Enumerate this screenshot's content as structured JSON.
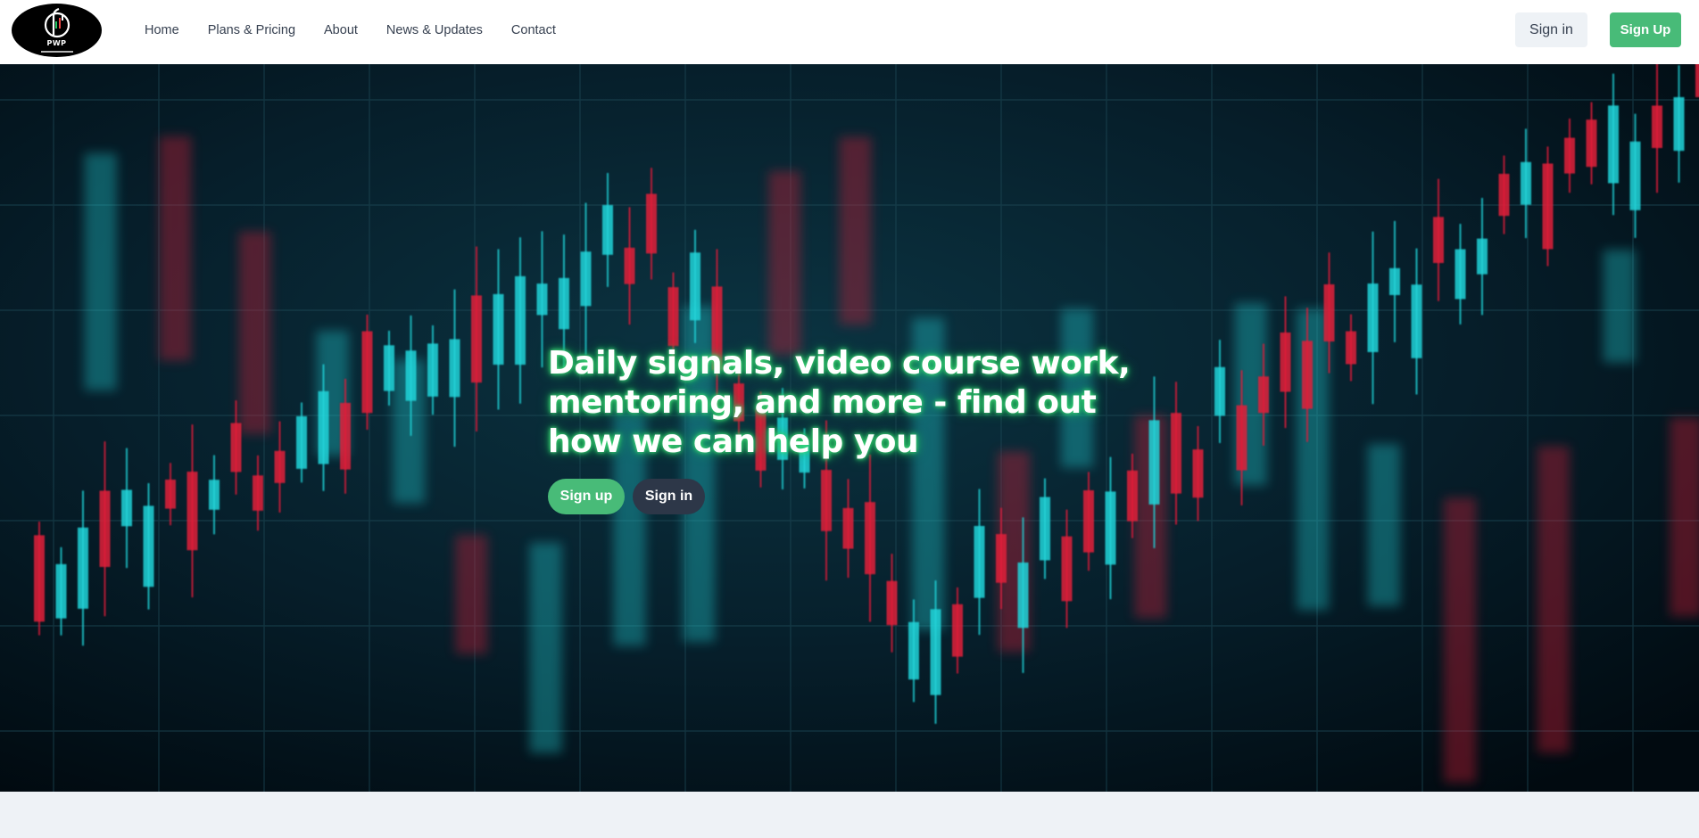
{
  "logo": {
    "text": "PWP",
    "icon": "pwp-logo-icon"
  },
  "nav": {
    "items": [
      {
        "label": "Home"
      },
      {
        "label": "Plans & Pricing"
      },
      {
        "label": "About"
      },
      {
        "label": "News & Updates"
      },
      {
        "label": "Contact"
      }
    ]
  },
  "header": {
    "signin_label": "Sign in",
    "signup_label": "Sign Up"
  },
  "hero": {
    "title": "Daily signals, video course work, mentoring, and more - find out how we can help you",
    "signup_label": "Sign up",
    "signin_label": "Sign in",
    "background": "candlestick-chart-image"
  },
  "colors": {
    "accent_green": "#48bb78",
    "dark_button": "#2d3748",
    "candle_up": "#22d3d8",
    "candle_down": "#e11d38",
    "hero_bg": "#02101a",
    "page_bg": "#eef2f6"
  }
}
